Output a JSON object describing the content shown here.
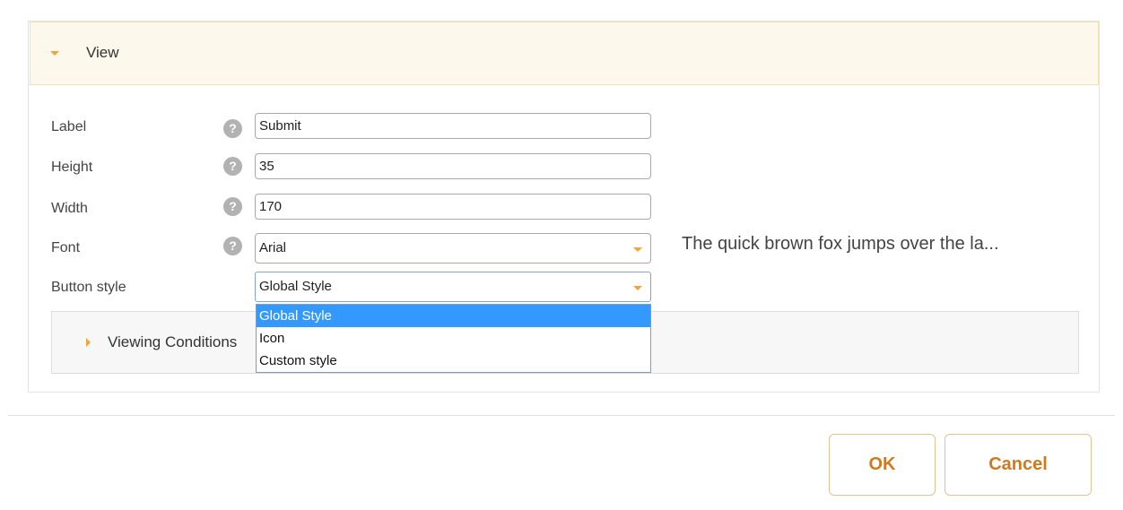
{
  "section": {
    "title": "View"
  },
  "fields": {
    "label": {
      "label": "Label",
      "value": "Submit",
      "help": "?"
    },
    "height": {
      "label": "Height",
      "value": "35",
      "help": "?"
    },
    "width": {
      "label": "Width",
      "value": "170",
      "help": "?"
    },
    "font": {
      "label": "Font",
      "value": "Arial",
      "help": "?",
      "preview": "The quick brown fox jumps over the la..."
    },
    "button_style": {
      "label": "Button style",
      "value": "Global Style",
      "options": [
        "Global Style",
        "Icon",
        "Custom style"
      ],
      "selected_index": 0
    }
  },
  "viewing_conditions": {
    "title": "Viewing Conditions"
  },
  "footer": {
    "ok_label": "OK",
    "cancel_label": "Cancel"
  },
  "colors": {
    "accent": "#f0a43c",
    "button_text": "#d07a1c",
    "highlight": "#3399ff",
    "header_bg": "#fcf8ec"
  },
  "icons": {
    "section_toggle": "chevron-down-icon",
    "sub_toggle": "chevron-right-icon",
    "help": "help-icon",
    "select": "dropdown-arrow-icon"
  }
}
